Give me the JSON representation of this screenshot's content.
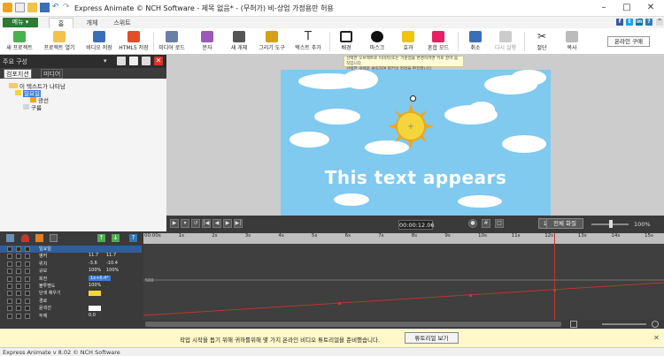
{
  "window": {
    "title": "Express Animate © NCH Software - 제목 없음* - (무허가) 비-상업 가정용만 허용"
  },
  "tabbar": {
    "menu_label": "메뉴",
    "tabs": [
      {
        "label": "홈"
      },
      {
        "label": "개체"
      },
      {
        "label": "스위트"
      }
    ]
  },
  "toolbar": {
    "items": [
      {
        "label": "새 프로젝트",
        "icon": "new-project-icon"
      },
      {
        "label": "프로젝트 열기",
        "icon": "open-project-icon"
      },
      {
        "label": "비디오 저장",
        "icon": "save-video-icon"
      },
      {
        "label": "HTML5 저장",
        "icon": "html5-icon"
      },
      {
        "label": "미디어 로드",
        "icon": "load-media-icon"
      },
      {
        "label": "문자",
        "icon": "character-icon"
      },
      {
        "label": "새 개체",
        "icon": "new-object-icon"
      },
      {
        "label": "그리기 도구",
        "icon": "draw-tools-icon"
      },
      {
        "label": "텍스트 추가",
        "icon": "text-icon"
      },
      {
        "label": "배경",
        "icon": "background-icon"
      },
      {
        "label": "마스크",
        "icon": "mask-icon"
      },
      {
        "label": "효과",
        "icon": "effects-icon"
      },
      {
        "label": "혼합 모드",
        "icon": "blend-icon"
      },
      {
        "label": "취소",
        "icon": "undo-icon"
      },
      {
        "label": "다시 실행",
        "icon": "redo-icon"
      },
      {
        "label": "절단",
        "icon": "cut-icon"
      },
      {
        "label": "복사",
        "icon": "copy-icon"
      }
    ],
    "buy_label": "온라인 구매"
  },
  "tooltip": {
    "line1": "선택한 오브젝트로 이미지(또는 기준점을 변경하려면 키로 끌어 움직입니다.",
    "line2": "선택한 개체로 클릭하여 회전의 정점을 편집합니다."
  },
  "left_panel": {
    "header": "주요 구성",
    "tabs": [
      {
        "label": "컴포지션"
      },
      {
        "label": "미디어"
      }
    ],
    "tree": [
      {
        "label": "이 텍스트가 나타남"
      },
      {
        "label": "일요일"
      },
      {
        "label": "광선"
      },
      {
        "label": "구름"
      }
    ]
  },
  "stage": {
    "text": "This text appears"
  },
  "transport": {
    "timecode": "00:00:12.06",
    "aspect": "16 : 9",
    "fullscreen_label": "전체 화질",
    "zoom": "100%"
  },
  "timeline": {
    "ticks": [
      "00:00s",
      "1s",
      "2s",
      "3s",
      "4s",
      "5s",
      "6s",
      "7s",
      "8s",
      "9s",
      "10s",
      "11s",
      "12s",
      "13s",
      "14s",
      "15s"
    ],
    "graph_label": "500",
    "properties": [
      {
        "name": "일요일",
        "v1": "",
        "v2": ""
      },
      {
        "name": "앵커",
        "v1": "11.7",
        "v2": "11.7"
      },
      {
        "name": "위치",
        "v1": "-3.6",
        "v2": "-10.4"
      },
      {
        "name": "규모",
        "v1": "100%",
        "v2": "100%"
      },
      {
        "name": "회전",
        "v1": "1x+6.4°",
        "v2": ""
      },
      {
        "name": "불투명도",
        "v1": "100%",
        "v2": ""
      },
      {
        "name": "단색 채우기",
        "v1": "",
        "v2": ""
      },
      {
        "name": "경로",
        "v1": "",
        "v2": ""
      },
      {
        "name": "윤곽선",
        "v1": "",
        "v2": ""
      },
      {
        "name": "두께",
        "v1": "0.0",
        "v2": ""
      }
    ]
  },
  "banner": {
    "text": "작업 시작을 돕기 위해 귀하를위해 몇 가지 온라인 비디오 튜토리얼을 준비했습니다.",
    "button": "튜토리얼 보기"
  },
  "status": {
    "text": "Express Animate v 8.02 © NCH Software"
  },
  "colors": {
    "menu": "#2b7b34",
    "sky": "#80c9ef",
    "sun": "#f5d53b",
    "playhead": "#c0392b",
    "banner": "#fff9c9"
  }
}
